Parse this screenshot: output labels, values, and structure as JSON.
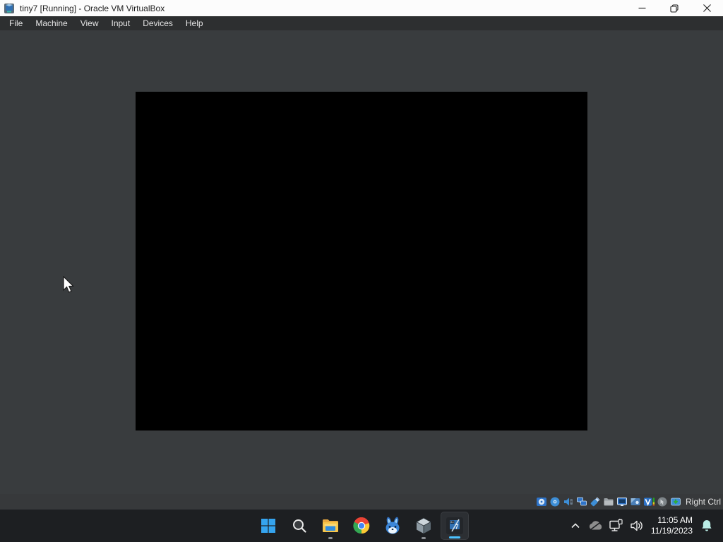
{
  "window": {
    "title": "tiny7 [Running] - Oracle VM VirtualBox",
    "app_icon": "virtualbox-vm-icon",
    "menu_items": [
      "File",
      "Machine",
      "View",
      "Input",
      "Devices",
      "Help"
    ],
    "caption_controls": [
      "minimize",
      "restore",
      "close"
    ]
  },
  "vm": {
    "screen_state": "black (no video output)",
    "cursor": "arrow cursor over gray client area"
  },
  "statusbar": {
    "icons": [
      "hard-disks",
      "optical-drives",
      "audio",
      "network",
      "usb",
      "shared-folders",
      "display",
      "recording",
      "features",
      "mouse-integration",
      "keyboard-host-key"
    ],
    "host_key_label": "Right Ctrl"
  },
  "taskbar": {
    "buttons": [
      "start",
      "search",
      "file-explorer",
      "chrome",
      "bunny-app",
      "virtualbox",
      "vm-window-tiny7"
    ],
    "running": [
      "file-explorer",
      "virtualbox"
    ],
    "active": "vm-window-tiny7",
    "tray_icons": [
      "hidden-icons-chevron",
      "onedrive-offline",
      "network",
      "volume",
      "notification-bell"
    ],
    "clock": {
      "time": "11:05 AM",
      "date": "11/19/2023"
    }
  },
  "colors": {
    "titlebar_bg": "#fcfcfc",
    "menubar_bg": "#2d2f30",
    "client_bg": "#393c3e",
    "taskbar_bg": "#1d1f22",
    "accent_blue": "#4cc2ff",
    "status_icon_blue": "#2e73c8",
    "bell_teal": "#b9ece5",
    "vm_screen": "#000000"
  }
}
